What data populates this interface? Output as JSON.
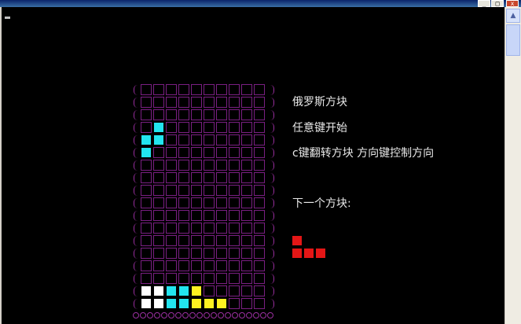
{
  "window": {
    "close_glyph": "x",
    "minimize_glyph": "_",
    "maximize_glyph": "□"
  },
  "info": {
    "title": "俄罗斯方块",
    "start_hint": "任意键开始",
    "controls_hint": "c键翻转方块 方向键控制方向",
    "next_label": "下一个方块:"
  },
  "colors": {
    "cyan": "#22e5ef",
    "white": "#ffffff",
    "yellow": "#fff221",
    "red": "#e41616",
    "grid": "#7a1f82",
    "wall": "#9a2fa0"
  },
  "board": {
    "rows": 18,
    "cols": 10,
    "active_piece": {
      "color": "cyan",
      "cells": [
        [
          3,
          1
        ],
        [
          4,
          0
        ],
        [
          4,
          1
        ],
        [
          5,
          0
        ]
      ]
    },
    "stack": [
      {
        "row": 16,
        "col": 0,
        "color": "white"
      },
      {
        "row": 16,
        "col": 1,
        "color": "white"
      },
      {
        "row": 16,
        "col": 2,
        "color": "cyan"
      },
      {
        "row": 16,
        "col": 3,
        "color": "cyan"
      },
      {
        "row": 16,
        "col": 4,
        "color": "yellow"
      },
      {
        "row": 17,
        "col": 0,
        "color": "white"
      },
      {
        "row": 17,
        "col": 1,
        "color": "white"
      },
      {
        "row": 17,
        "col": 2,
        "color": "cyan"
      },
      {
        "row": 17,
        "col": 3,
        "color": "cyan"
      },
      {
        "row": 17,
        "col": 4,
        "color": "yellow"
      },
      {
        "row": 17,
        "col": 5,
        "color": "yellow"
      },
      {
        "row": 17,
        "col": 6,
        "color": "yellow"
      }
    ]
  },
  "next_piece": {
    "color": "red",
    "cells": [
      [
        0,
        0
      ],
      [
        1,
        0
      ],
      [
        1,
        1
      ],
      [
        1,
        2
      ]
    ]
  }
}
